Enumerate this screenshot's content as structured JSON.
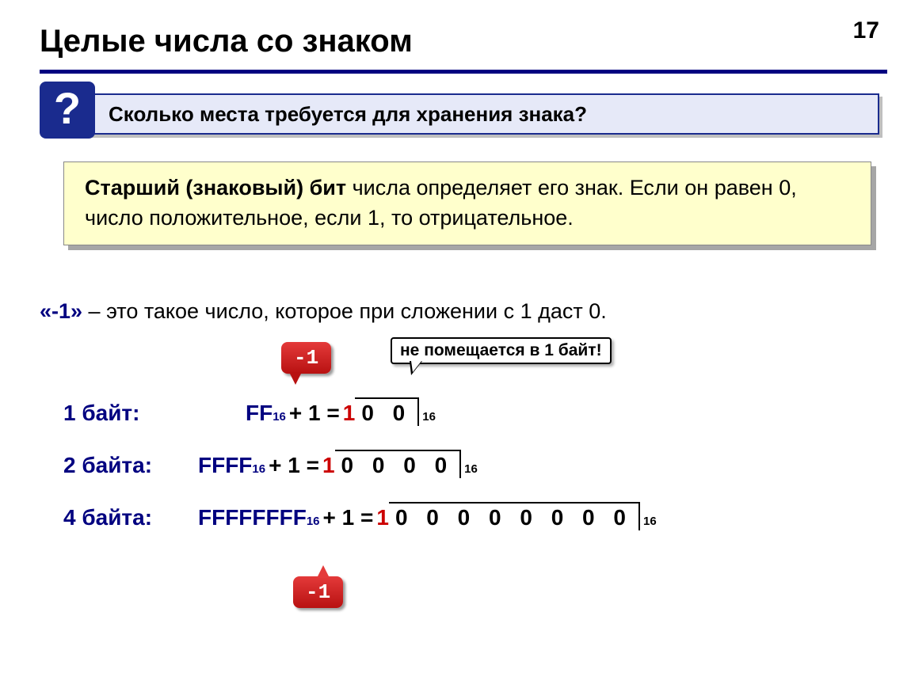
{
  "page_number": "17",
  "title": "Целые числа со знаком",
  "question_mark": "?",
  "question_text": "Сколько места требуется для хранения знака?",
  "info_bold": "Старший (знаковый) бит",
  "info_rest": " числа определяет его знак. Если он равен 0, число положительное, если 1, то отрицательное.",
  "para_accent": "«-1»",
  "para_rest": " – это такое число, которое при сложении с 1 даст 0.",
  "callout_minus1": "-1",
  "note_text": "не помещается в 1 байт!",
  "rows": {
    "r1": {
      "label": "1 байт:",
      "hex": "FF",
      "sub": "16",
      "plus": " + 1 = ",
      "red": "1",
      "result": "0 0",
      "result_sub": "16"
    },
    "r2": {
      "label": "2 байта:",
      "hex": "FFFF",
      "sub": "16",
      "plus": " + 1 = ",
      "red": "1",
      "result": "0 0 0 0",
      "result_sub": "16"
    },
    "r3": {
      "label": "4 байта:",
      "hex": "FFFFFFFF",
      "sub": "16",
      "plus": " + 1 = ",
      "red": "1",
      "result": "0 0 0 0 0 0 0 0",
      "result_sub": "16"
    }
  }
}
